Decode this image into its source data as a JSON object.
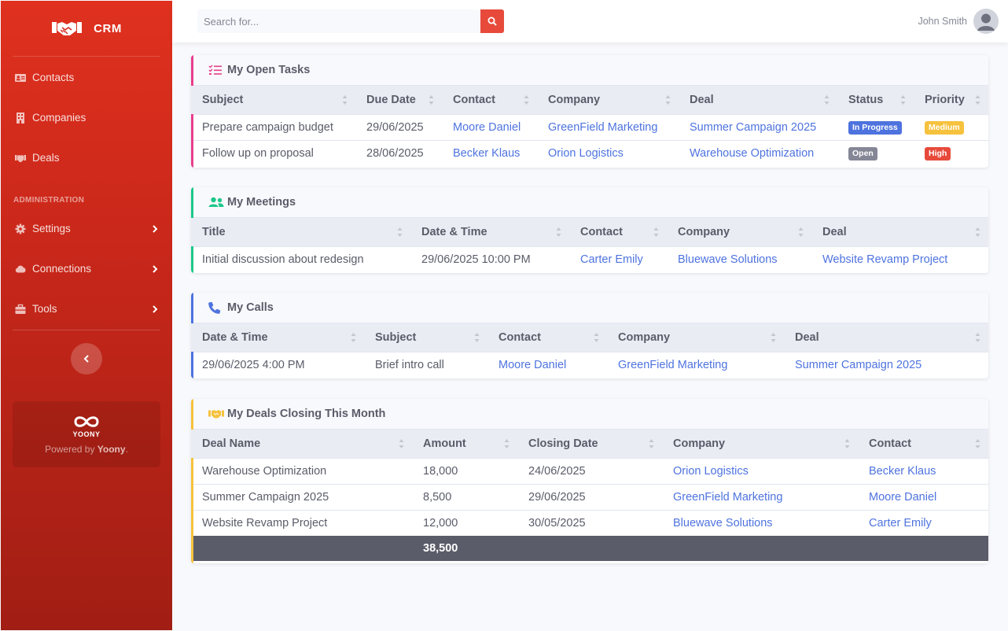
{
  "brand": {
    "name": "CRM"
  },
  "sidebar": {
    "items": [
      {
        "label": "Contacts",
        "icon": "address-card-icon"
      },
      {
        "label": "Companies",
        "icon": "building-icon"
      },
      {
        "label": "Deals",
        "icon": "handshake-icon"
      }
    ],
    "admin_heading": "ADMINISTRATION",
    "admin_items": [
      {
        "label": "Settings",
        "icon": "gear-icon"
      },
      {
        "label": "Connections",
        "icon": "cloud-icon"
      },
      {
        "label": "Tools",
        "icon": "toolbox-icon"
      }
    ],
    "powered_logo": "YOONY",
    "powered_prefix": "Powered by ",
    "powered_brand": "Yoony",
    "powered_suffix": "."
  },
  "topbar": {
    "search_placeholder": "Search for...",
    "user_name": "John Smith"
  },
  "tasks": {
    "title": "My Open Tasks",
    "accent": "#e83e8c",
    "columns": [
      "Subject",
      "Due Date",
      "Contact",
      "Company",
      "Deal",
      "Status",
      "Priority"
    ],
    "rows": [
      {
        "subject": "Prepare campaign budget",
        "due": "29/06/2025",
        "contact": "Moore Daniel",
        "company": "GreenField Marketing",
        "deal": "Summer Campaign 2025",
        "status": "In Progress",
        "status_color": "#4e73df",
        "priority": "Medium",
        "priority_color": "#f6c23e"
      },
      {
        "subject": "Follow up on proposal",
        "due": "28/06/2025",
        "contact": "Becker Klaus",
        "company": "Orion Logistics",
        "deal": "Warehouse Optimization",
        "status": "Open",
        "status_color": "#858796",
        "priority": "High",
        "priority_color": "#e74a3b"
      }
    ]
  },
  "meetings": {
    "title": "My Meetings",
    "accent": "#1cc88a",
    "columns": [
      "Title",
      "Date & Time",
      "Contact",
      "Company",
      "Deal"
    ],
    "rows": [
      {
        "title": "Initial discussion about redesign",
        "datetime": "29/06/2025 10:00 PM",
        "contact": "Carter Emily",
        "company": "Bluewave Solutions",
        "deal": "Website Revamp Project"
      }
    ]
  },
  "calls": {
    "title": "My Calls",
    "accent": "#4e73df",
    "columns": [
      "Date & Time",
      "Subject",
      "Contact",
      "Company",
      "Deal"
    ],
    "rows": [
      {
        "datetime": "29/06/2025 4:00 PM",
        "subject": "Brief intro call",
        "contact": "Moore Daniel",
        "company": "GreenField Marketing",
        "deal": "Summer Campaign 2025"
      }
    ]
  },
  "deals": {
    "title": "My Deals Closing This Month",
    "accent": "#f6c23e",
    "columns": [
      "Deal Name",
      "Amount",
      "Closing Date",
      "Company",
      "Contact"
    ],
    "rows": [
      {
        "name": "Warehouse Optimization",
        "amount": "18,000",
        "closing": "24/06/2025",
        "company": "Orion Logistics",
        "contact": "Becker Klaus"
      },
      {
        "name": "Summer Campaign 2025",
        "amount": "8,500",
        "closing": "29/06/2025",
        "company": "GreenField Marketing",
        "contact": "Moore Daniel"
      },
      {
        "name": "Website Revamp Project",
        "amount": "12,000",
        "closing": "30/05/2025",
        "company": "Bluewave Solutions",
        "contact": "Carter Emily"
      }
    ],
    "total": "38,500"
  }
}
